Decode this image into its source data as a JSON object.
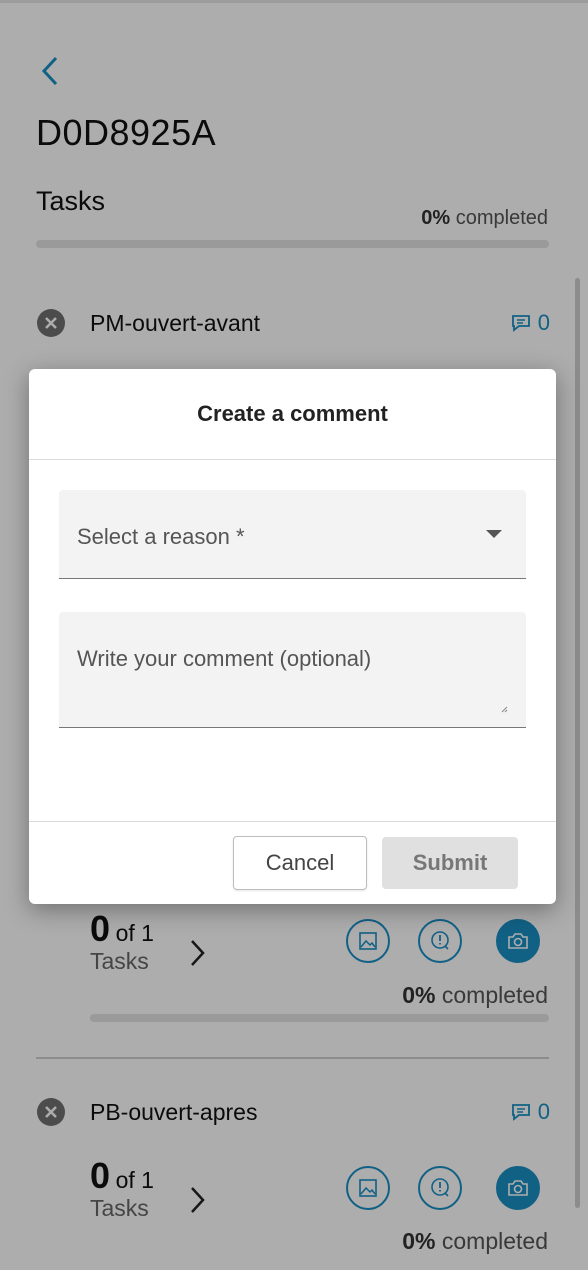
{
  "header": {
    "title": "D0D8925A",
    "section": "Tasks",
    "progress_value": "0%",
    "progress_word": "completed",
    "progress": 0
  },
  "tasks": [
    {
      "name": "PM-ouvert-avant",
      "comments": "0"
    },
    {
      "count": "0",
      "of": "of 1",
      "label": "Tasks",
      "pct": "0%",
      "pct_word": "completed"
    },
    {
      "name": "PB-ouvert-apres",
      "comments": "0",
      "count": "0",
      "of": "of 1",
      "label": "Tasks",
      "pct": "0%",
      "pct_word": "completed"
    }
  ],
  "dialog": {
    "title": "Create a comment",
    "reason_placeholder": "Select a reason *",
    "comment_placeholder": "Write your comment (optional)",
    "cancel_label": "Cancel",
    "submit_label": "Submit"
  },
  "colors": {
    "accent": "#1a8fc4",
    "overlay": "rgba(0,0,0,0.32)"
  },
  "icons": [
    "back-chevron-icon",
    "close-circle-icon",
    "comment-icon",
    "chevron-right-icon",
    "image-icon",
    "alert-comment-icon",
    "camera-icon",
    "dropdown-arrow-icon"
  ]
}
